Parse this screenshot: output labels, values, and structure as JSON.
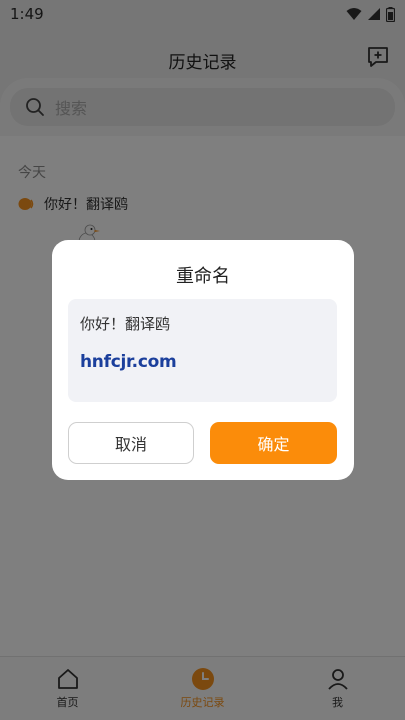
{
  "status_bar": {
    "time": "1:49"
  },
  "header": {
    "title": "历史记录"
  },
  "search": {
    "placeholder": "搜索"
  },
  "history": {
    "section_label": "今天",
    "items": [
      {
        "label": "你好！翻译鸥"
      }
    ]
  },
  "bottom_nav": {
    "items": [
      {
        "label": "首页",
        "icon": "home-icon",
        "active": false
      },
      {
        "label": "历史记录",
        "icon": "clock-icon",
        "active": true
      },
      {
        "label": "我",
        "icon": "person-icon",
        "active": false
      }
    ]
  },
  "dialog": {
    "title": "重命名",
    "input_value": "你好！翻译鸥",
    "watermark": "hnfcjr.com",
    "cancel_label": "取消",
    "confirm_label": "确定"
  },
  "colors": {
    "accent": "#fb8c0a",
    "overlay": "rgba(0,0,0,0.5)",
    "watermark": "#1b3f9c"
  }
}
